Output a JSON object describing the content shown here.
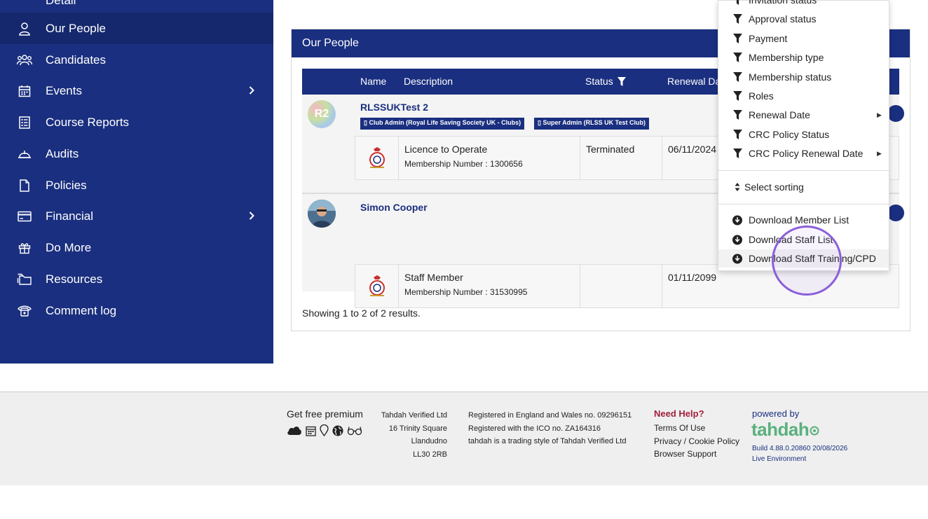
{
  "sidebar": {
    "items": [
      {
        "label": "Detail",
        "icon": "grid-icon",
        "active": false
      },
      {
        "label": "Our People",
        "icon": "person-icon",
        "active": true
      },
      {
        "label": "Candidates",
        "icon": "group-icon",
        "active": false
      },
      {
        "label": "Events",
        "icon": "calendar-icon",
        "active": false,
        "has_submenu": true
      },
      {
        "label": "Course Reports",
        "icon": "report-icon",
        "active": false
      },
      {
        "label": "Audits",
        "icon": "hardhat-icon",
        "active": false
      },
      {
        "label": "Policies",
        "icon": "document-icon",
        "active": false
      },
      {
        "label": "Financial",
        "icon": "credit-card-icon",
        "active": false,
        "has_submenu": true
      },
      {
        "label": "Do More",
        "icon": "gift-icon",
        "active": false
      },
      {
        "label": "Resources",
        "icon": "folders-icon",
        "active": false
      },
      {
        "label": "Comment log",
        "icon": "phone-icon",
        "active": false
      }
    ]
  },
  "panel": {
    "title": "Our People",
    "columns": {
      "name": "Name",
      "description": "Description",
      "status": "Status",
      "renewal": "Renewal Da"
    },
    "people": [
      {
        "avatar_text": "R2",
        "name": "RLSSUKTest 2",
        "roles": [
          "Club Admin (Royal Life Saving Society UK - Clubs)",
          "Super Admin (RLSS UK Test Club)"
        ],
        "membership": {
          "title": "Licence to Operate",
          "number": "Membership Number : 1300656",
          "status": "Terminated",
          "renewal": "06/11/2024"
        }
      },
      {
        "avatar_text": "",
        "name": "Simon Cooper",
        "roles": [],
        "membership": {
          "title": "Staff Member",
          "number": "Membership Number : 31530995",
          "status": "",
          "renewal": "01/11/2099"
        }
      }
    ],
    "results_text": "Showing 1 to 2 of 2 results."
  },
  "dropdown": {
    "filters": [
      {
        "label": "Invitation status",
        "has_submenu": false
      },
      {
        "label": "Approval status",
        "has_submenu": false
      },
      {
        "label": "Payment",
        "has_submenu": false
      },
      {
        "label": "Membership type",
        "has_submenu": false
      },
      {
        "label": "Membership status",
        "has_submenu": false
      },
      {
        "label": "Roles",
        "has_submenu": false
      },
      {
        "label": "Renewal Date",
        "has_submenu": true
      },
      {
        "label": "CRC Policy Status",
        "has_submenu": false
      },
      {
        "label": "CRC Policy Renewal Date",
        "has_submenu": true
      }
    ],
    "sorting_label": "Select sorting",
    "downloads": [
      "Download Member List",
      "Download Staff List",
      "Download Staff Training/CPD"
    ]
  },
  "footer": {
    "premium_label": "Get free premium",
    "address": [
      "Tahdah Verified Ltd",
      "16 Trinity Square",
      "Llandudno",
      "LL30 2RB"
    ],
    "registration": [
      "Registered in England and Wales no. 09296151",
      "Registered with the ICO no. ZA164316",
      "tahdah is a trading style of Tahdah Verified Ltd"
    ],
    "help_title": "Need Help?",
    "help_links": [
      "Terms Of Use",
      "Privacy / Cookie Policy",
      "Browser Support"
    ],
    "powered_by": "powered by",
    "logo_text": "tahdah",
    "build": "Build 4.88.0.20860 20/08/2026",
    "environment": "Live Environment"
  },
  "colors": {
    "brand_navy": "#1a2f7f",
    "help_red": "#a0203a",
    "logo_green": "#5bb07e",
    "highlight": "#8a5fd8"
  }
}
